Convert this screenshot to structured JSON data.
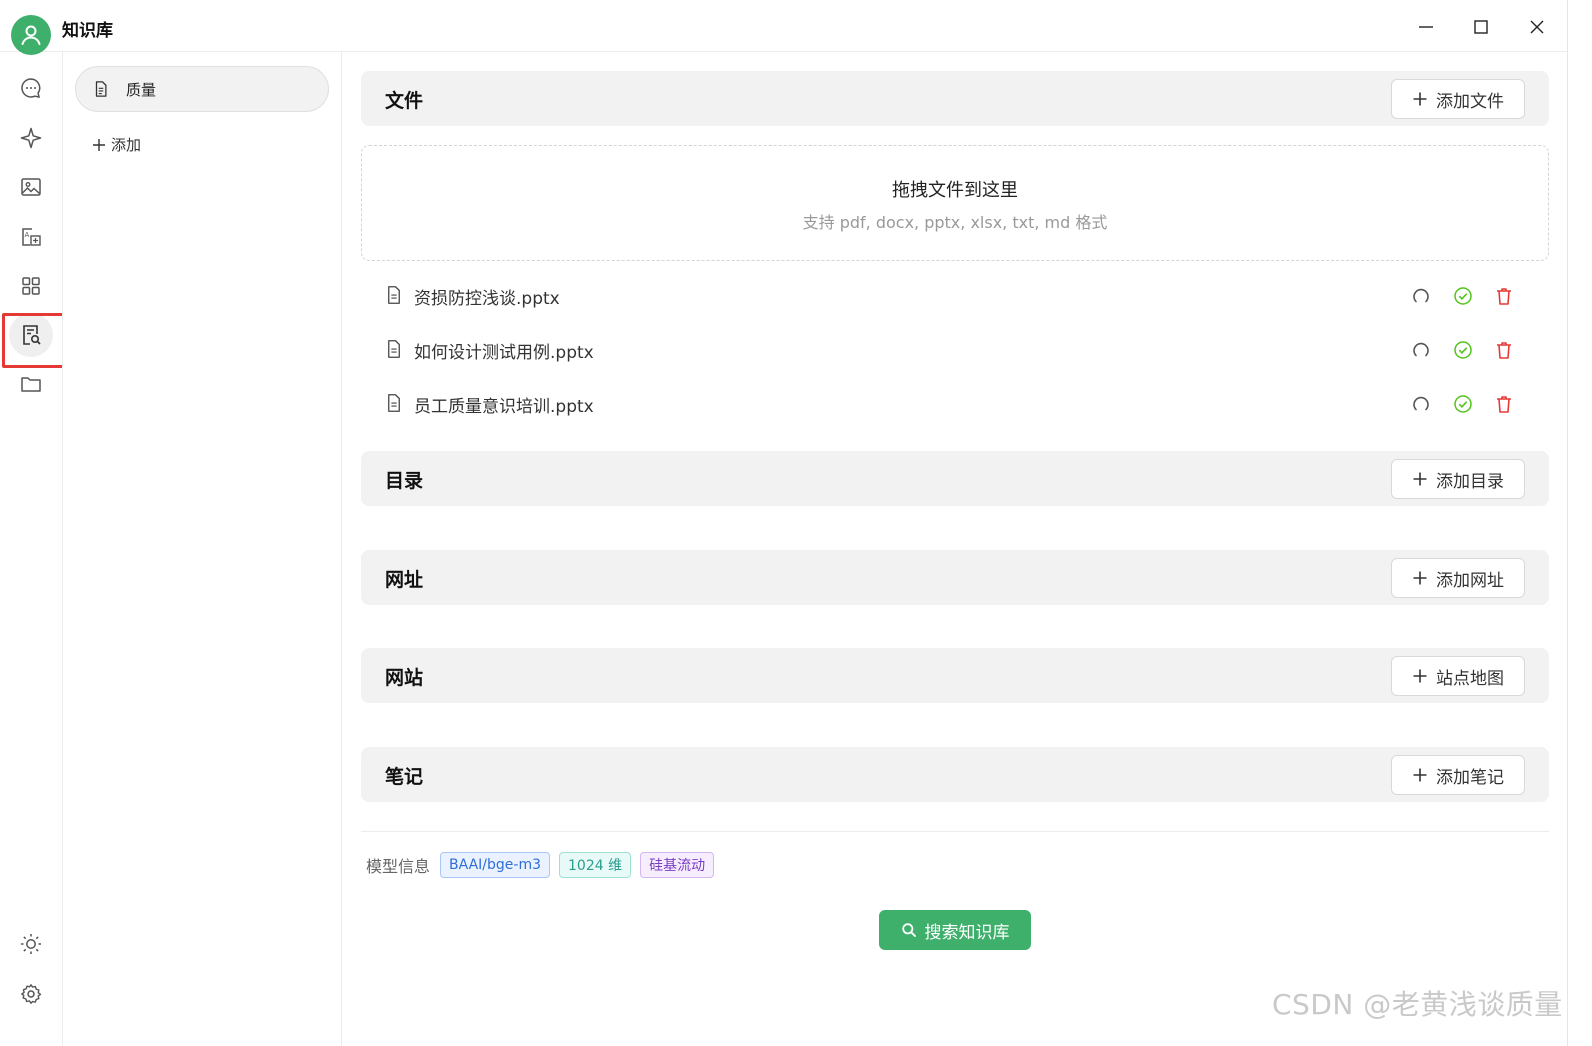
{
  "app": {
    "title": "知识库"
  },
  "window_controls": [
    "minimize",
    "maximize",
    "close"
  ],
  "rail": {
    "items": [
      {
        "icon": "chat-icon",
        "active": false
      },
      {
        "icon": "sparkle-icon",
        "active": false
      },
      {
        "icon": "image-icon",
        "active": false
      },
      {
        "icon": "translate-icon",
        "active": false
      },
      {
        "icon": "apps-grid-icon",
        "active": false
      },
      {
        "icon": "knowledge-search-icon",
        "active": true
      },
      {
        "icon": "folder-icon",
        "active": false
      }
    ],
    "bottom": [
      {
        "icon": "sun-icon"
      },
      {
        "icon": "settings-gear-icon"
      }
    ]
  },
  "kb_list": {
    "items": [
      {
        "label": "质量",
        "icon": "document-icon"
      }
    ],
    "add_label": "添加"
  },
  "sections": {
    "files": {
      "title": "文件",
      "button": "添加文件"
    },
    "directory": {
      "title": "目录",
      "button": "添加目录"
    },
    "url": {
      "title": "网址",
      "button": "添加网址"
    },
    "website": {
      "title": "网站",
      "button": "站点地图"
    },
    "notes": {
      "title": "笔记",
      "button": "添加笔记"
    }
  },
  "dropzone": {
    "title": "拖拽文件到这里",
    "subtitle": "支持 pdf, docx, pptx, xlsx, txt, md 格式"
  },
  "files": [
    {
      "name": "资损防控浅谈.pptx"
    },
    {
      "name": "如何设计测试用例.pptx"
    },
    {
      "name": "员工质量意识培训.pptx"
    }
  ],
  "model_info": {
    "label": "模型信息",
    "tags": [
      "BAAI/bge-m3",
      "1024 维",
      "硅基流动"
    ]
  },
  "search_button": "搜索知识库",
  "watermark": "CSDN @老黄浅谈质量",
  "colors": {
    "accent": "#3fb06c",
    "highlight_box": "#e53935",
    "delete": "#e53935",
    "done": "#52c41a"
  }
}
